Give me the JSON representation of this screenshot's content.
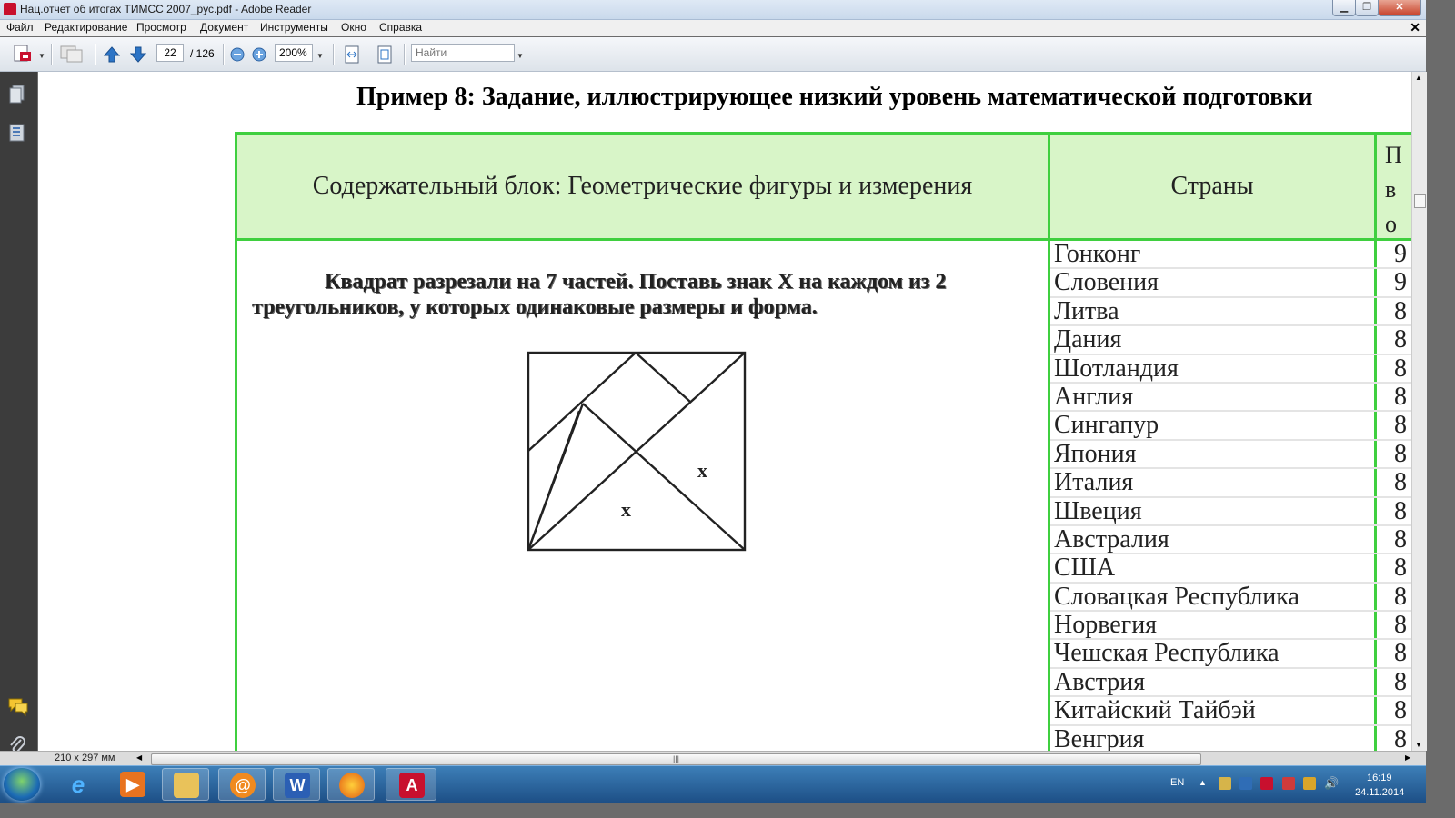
{
  "window": {
    "title": "Нац.отчет об итогах ТИМСС 2007_рус.pdf - Adobe Reader"
  },
  "menu": [
    "Файл",
    "Редактирование",
    "Просмотр",
    "Документ",
    "Инструменты",
    "Окно",
    "Справка"
  ],
  "toolbar": {
    "current_page": "22",
    "total_pages": "/ 126",
    "zoom": "200%",
    "find_placeholder": "Найти"
  },
  "document": {
    "heading": "Пример 8: Задание, иллюстрирующее низкий уровень математической подготовки",
    "table_header": {
      "block": "Содержательный блок: Геометрические фигуры и измерения",
      "countries": "Страны",
      "third_partial": [
        "П",
        "в",
        "о"
      ]
    },
    "task_text": "Квадрат разрезали на 7 частей. Поставь знак X на каждом из 2 треугольников, у которых одинаковые размеры и форма.",
    "figure_marks": [
      "x",
      "x"
    ],
    "countries": [
      {
        "name": "Гонконг",
        "value": "9"
      },
      {
        "name": "Словения",
        "value": "9"
      },
      {
        "name": "Литва",
        "value": "8"
      },
      {
        "name": "Дания",
        "value": "8"
      },
      {
        "name": "Шотландия",
        "value": "8"
      },
      {
        "name": "Англия",
        "value": "8"
      },
      {
        "name": "Сингапур",
        "value": "8"
      },
      {
        "name": "Япония",
        "value": "8"
      },
      {
        "name": "Италия",
        "value": "8"
      },
      {
        "name": "Швеция",
        "value": "8"
      },
      {
        "name": "Австралия",
        "value": "8"
      },
      {
        "name": "США",
        "value": "8"
      },
      {
        "name": "Словацкая Республика",
        "value": "8"
      },
      {
        "name": "Норвегия",
        "value": "8"
      },
      {
        "name": "Чешская Республика",
        "value": "8"
      },
      {
        "name": "Австрия",
        "value": "8"
      },
      {
        "name": "Китайский Тайбэй",
        "value": "8"
      },
      {
        "name": "Венгрия",
        "value": "8"
      }
    ]
  },
  "statusbar": {
    "page_size": "210 x 297 мм"
  },
  "taskbar": {
    "language": "EN",
    "time": "16:19",
    "date": "24.11.2014"
  }
}
